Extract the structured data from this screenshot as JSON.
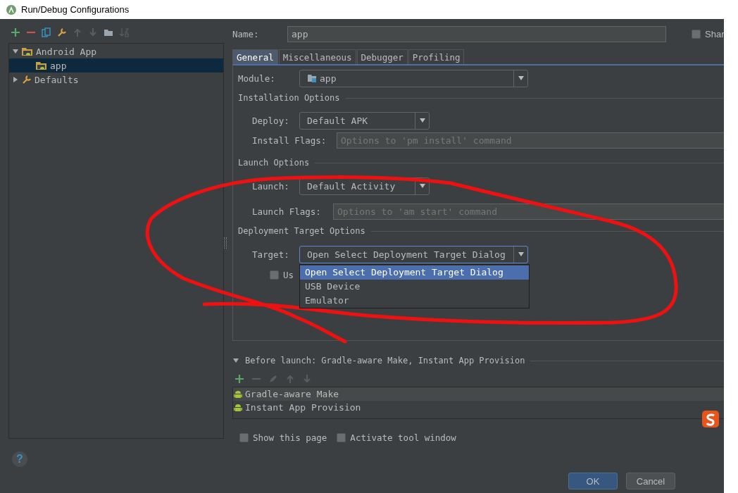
{
  "window": {
    "title": "Run/Debug Configurations"
  },
  "toolbar": [
    {
      "kind": "add",
      "disabled": false
    },
    {
      "kind": "remove",
      "disabled": false
    },
    {
      "kind": "copy",
      "disabled": false
    },
    {
      "kind": "wrench",
      "disabled": false
    },
    {
      "kind": "up",
      "disabled": true
    },
    {
      "kind": "down",
      "disabled": true
    },
    {
      "kind": "folder",
      "disabled": false
    },
    {
      "kind": "sort",
      "disabled": true
    }
  ],
  "tree": [
    {
      "label": "Android App",
      "kind": "android",
      "expanded": true,
      "selected": false,
      "children": [
        {
          "label": "app",
          "kind": "android",
          "selected": false,
          "highlight": true
        }
      ]
    },
    {
      "label": "Defaults",
      "kind": "defaults",
      "expanded": false,
      "selected": false
    }
  ],
  "name": {
    "label": "Name:",
    "value": "app"
  },
  "share": {
    "label": "Shar",
    "checked": false
  },
  "tabs": [
    {
      "label": "General",
      "selected": true
    },
    {
      "label": "Miscellaneous",
      "selected": false
    },
    {
      "label": "Debugger",
      "selected": false
    },
    {
      "label": "Profiling",
      "selected": false
    }
  ],
  "module": {
    "label": "Module:",
    "value": "app"
  },
  "installation": {
    "title": "Installation Options",
    "deploy": {
      "label": "Deploy:",
      "value": "Default APK"
    },
    "flags": {
      "label": "Install Flags:",
      "placeholder": "Options to 'pm install' command"
    }
  },
  "launch": {
    "title": "Launch Options",
    "launch": {
      "label": "Launch:",
      "value": "Default Activity"
    },
    "flags": {
      "label": "Launch Flags:",
      "placeholder": "Options to 'am start' command"
    }
  },
  "deployment": {
    "title": "Deployment Target Options",
    "target": {
      "label": "Target:",
      "value": "Open Select Deployment Target Dialog",
      "expanded": true,
      "options": [
        {
          "label": "Open Select Deployment Target Dialog",
          "selected": true
        },
        {
          "label": "USB Device",
          "selected": false
        },
        {
          "label": "Emulator",
          "selected": false
        }
      ]
    },
    "use": {
      "label": "Us",
      "checked": false
    }
  },
  "before_launch": {
    "title": "Before launch: Gradle-aware Make, Instant App Provision",
    "expanded": true,
    "toolbar": [
      {
        "kind": "add",
        "disabled": false
      },
      {
        "kind": "remove",
        "disabled": true
      },
      {
        "kind": "edit",
        "disabled": true
      },
      {
        "kind": "up",
        "disabled": true
      },
      {
        "kind": "down",
        "disabled": true
      }
    ],
    "tasks": [
      {
        "label": "Gradle-aware Make",
        "selected": true
      },
      {
        "label": "Instant App Provision",
        "selected": false
      }
    ]
  },
  "options": [
    {
      "label": "Show this page",
      "checked": false
    },
    {
      "label": "Activate tool window",
      "checked": false
    }
  ],
  "help": "?",
  "buttons": [
    {
      "label": "OK",
      "kind": "default"
    },
    {
      "label": "Cancel",
      "kind": "normal"
    }
  ]
}
